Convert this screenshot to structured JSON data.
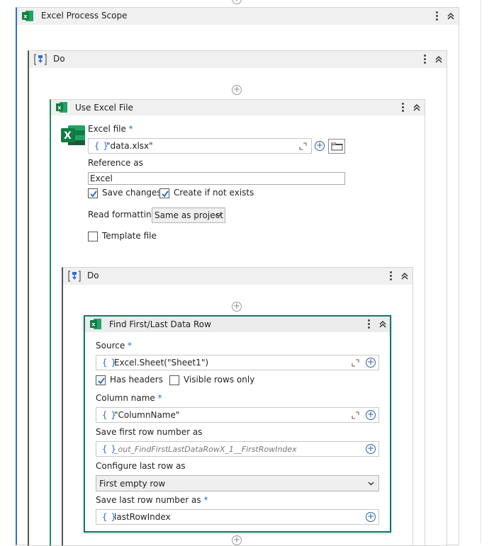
{
  "outer_scope": {
    "title": "Excel Process Scope"
  },
  "do_outer": {
    "title": "Do"
  },
  "use_excel": {
    "title": "Use Excel File",
    "excel_file_label": "Excel file",
    "required_marker": "*",
    "excel_file_value": "\"data.xlsx\"",
    "reference_label": "Reference as",
    "reference_value": "Excel",
    "save_changes_label": "Save changes",
    "save_changes_checked": true,
    "create_if_not_exists_label": "Create if not exists",
    "create_if_not_exists_checked": true,
    "read_formatting_label": "Read formatting",
    "read_formatting_value": "Same as project",
    "template_file_label": "Template file",
    "template_file_checked": false
  },
  "do_inner": {
    "title": "Do"
  },
  "find_row": {
    "title": "Find First/Last Data Row",
    "required_marker": "*",
    "source_label": "Source",
    "source_value": "Excel.Sheet(\"Sheet1\")",
    "has_headers_label": "Has headers",
    "has_headers_checked": true,
    "visible_rows_label": "Visible rows only",
    "visible_rows_checked": false,
    "column_name_label": "Column name",
    "column_name_value": "\"ColumnName\"",
    "save_first_label": "Save first row number as",
    "save_first_placeholder": "_out_FindFirstLastDataRowX_1__FirstRowIndex",
    "configure_last_label": "Configure last row as",
    "configure_last_value": "First empty row",
    "save_last_label": "Save last row number as",
    "save_last_value": "lastRowIndex"
  },
  "icons": {
    "brace": "{ }",
    "plus": "+"
  },
  "colors": {
    "scope_border_blue": "#2b6fcf",
    "use_excel_border_green": "#1f8a5a",
    "selected_border_teal": "#167a6a",
    "excel_green": "#1d6f42",
    "expression_blue": "#2a6fd0",
    "header_gray": "#f0f0f0"
  }
}
